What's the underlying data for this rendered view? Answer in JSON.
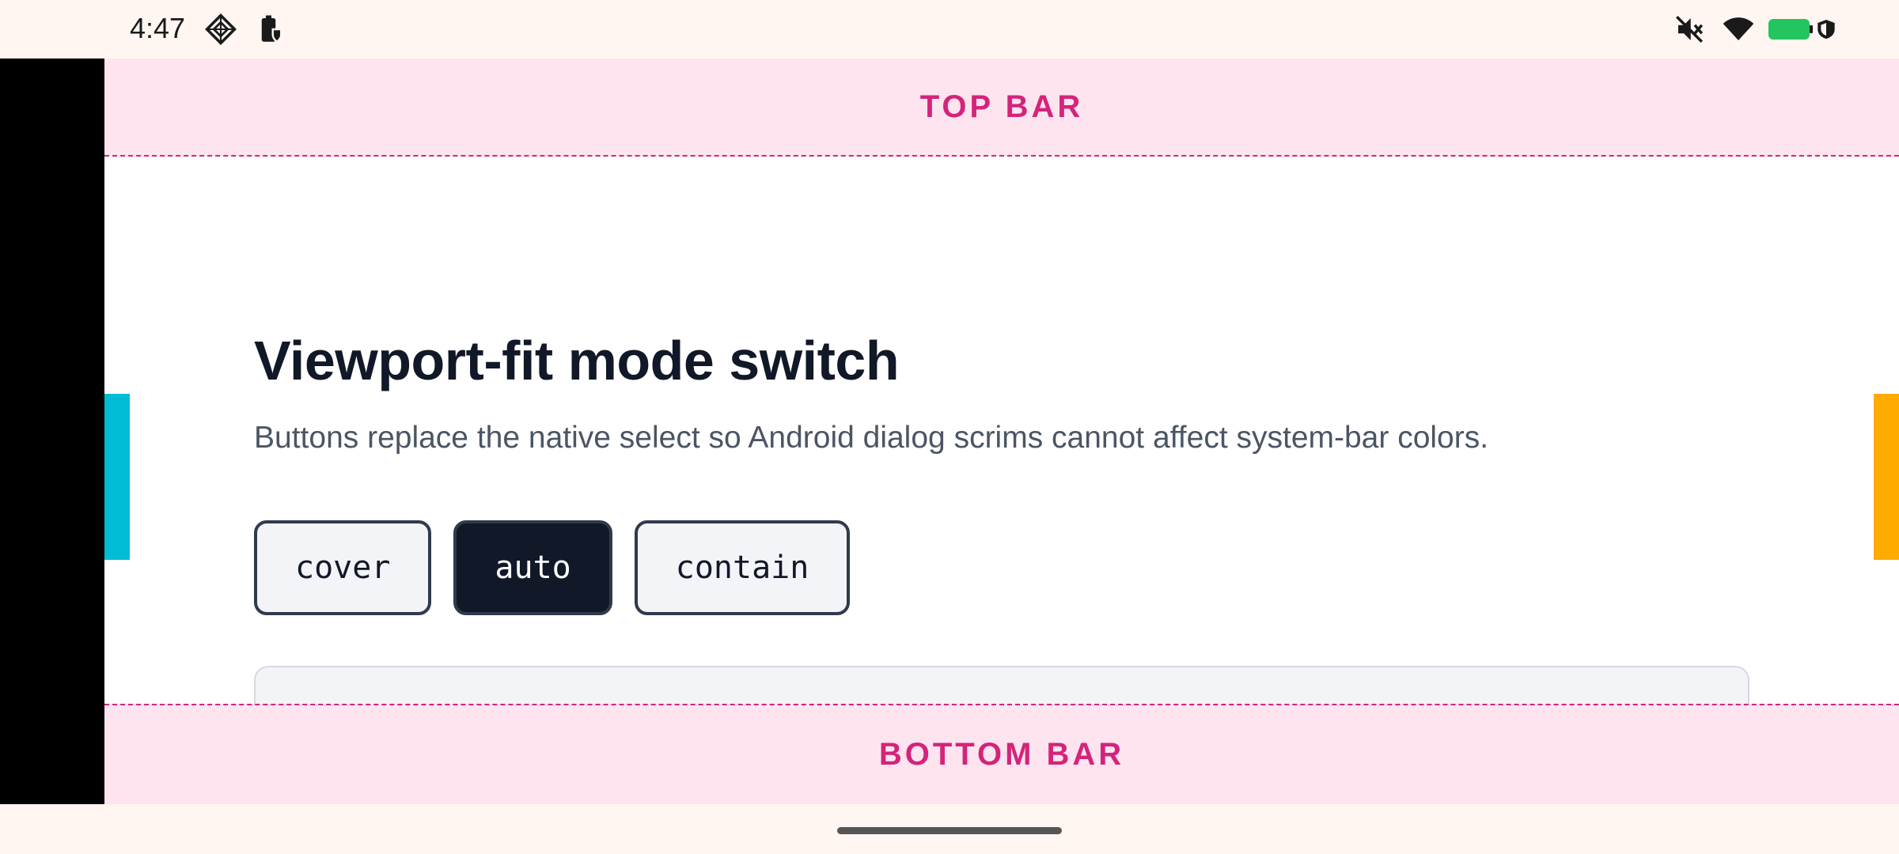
{
  "status_bar": {
    "time": "4:47",
    "left_icons": [
      "ar-core-icon",
      "battery-saver-icon"
    ],
    "right_icons": [
      "mute-icon",
      "wifi-icon",
      "battery-icon",
      "shield-icon"
    ],
    "battery_color": "#22c55e"
  },
  "app": {
    "top_bar_label": "TOP BAR",
    "bottom_bar_label": "BOTTOM BAR",
    "title": "Viewport-fit mode switch",
    "description": "Buttons replace the native select so Android dialog scrims cannot affect system-bar colors.",
    "mode_buttons": [
      {
        "label": "cover",
        "active": false
      },
      {
        "label": "auto",
        "active": true
      },
      {
        "label": "contain",
        "active": false
      }
    ],
    "colors": {
      "bar_background": "#fde4ef",
      "bar_accent": "#d4247a",
      "left_edge": "#00bcd4",
      "right_edge": "#ffab00",
      "active_button": "#111827"
    }
  }
}
